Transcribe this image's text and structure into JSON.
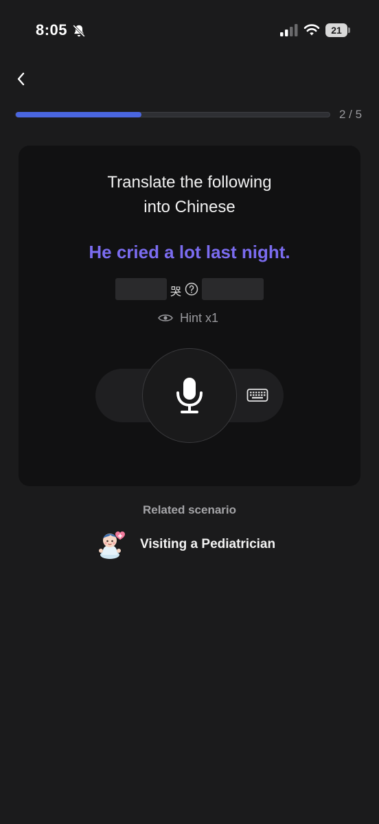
{
  "status_bar": {
    "time": "8:05",
    "battery_level": "21"
  },
  "progress": {
    "label": "2 / 5",
    "fraction": 0.4
  },
  "card": {
    "instruction_line1": "Translate the following",
    "instruction_line2": "into Chinese",
    "prompt": "He cried a lot last night.",
    "given_char": "哭",
    "hint_label": "Hint x1"
  },
  "related": {
    "title": "Related scenario",
    "scenario_label": "Visiting a Pediatrician"
  },
  "colors": {
    "accent": "#4a66e0",
    "prompt": "#7b6cf0",
    "background": "#1b1b1c",
    "card": "#111112"
  },
  "icons": [
    "back-icon",
    "bell-off-icon",
    "signal-icon",
    "wifi-icon",
    "battery-icon",
    "question-icon",
    "eye-icon",
    "microphone-icon",
    "keyboard-icon",
    "baby-icon"
  ]
}
